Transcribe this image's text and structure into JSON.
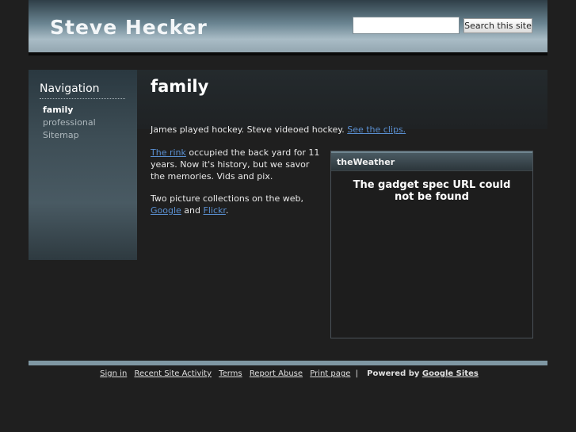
{
  "header": {
    "site_title": "Steve Hecker",
    "search_placeholder": "",
    "search_button": "Search this site"
  },
  "sidebar": {
    "title": "Navigation",
    "items": [
      {
        "label": "family",
        "active": true
      },
      {
        "label": "professional",
        "active": false
      },
      {
        "label": "Sitemap",
        "active": false
      }
    ]
  },
  "page": {
    "title": "family",
    "para1_text": "James played hockey.  Steve videoed hockey.  ",
    "para1_link": "See the clips.",
    "para2_link": "The rink",
    "para2_text": " occupied the back yard for 11 years.  Now it's history, but we savor the memories. Vids and pix.",
    "para3_text": "Two picture collections on the web,",
    "para3_link1": "Google",
    "para3_and": " and ",
    "para3_link2": "Flickr",
    "para3_end": "."
  },
  "gadget": {
    "title": "theWeather",
    "message": "The gadget spec URL could not be found"
  },
  "footer": {
    "links": [
      "Sign in",
      "Recent Site Activity",
      "Terms",
      "Report Abuse",
      "Print page"
    ],
    "separator": "|",
    "powered_by": "Powered by",
    "powered_link": "Google Sites"
  }
}
